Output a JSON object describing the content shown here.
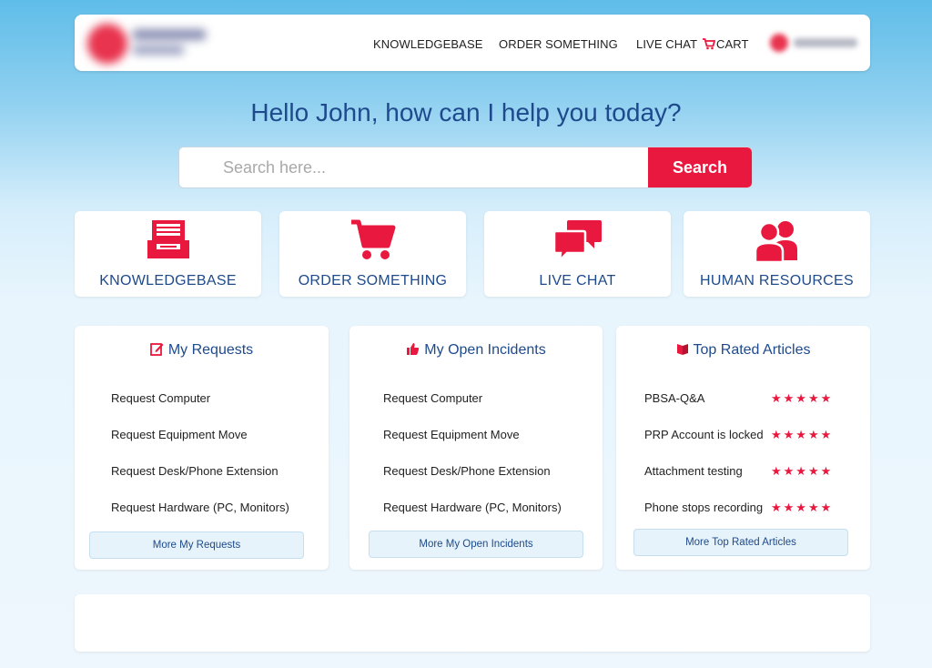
{
  "colors": {
    "accent": "#e8183f",
    "title_blue": "#1e4a8c",
    "button_bg": "#e6f3fb"
  },
  "nav": {
    "knowledgebase": "KNOWLEDGEBASE",
    "order": "ORDER SOMETHING",
    "chat": "LIVE CHAT",
    "cart": "CART"
  },
  "greeting": "Hello John, how can I help you today?",
  "search": {
    "placeholder": "Search here...",
    "button": "Search"
  },
  "tiles": [
    {
      "label": "KNOWLEDGEBASE",
      "icon": "archive-tray-icon"
    },
    {
      "label": "ORDER SOMETHING",
      "icon": "shopping-cart-icon"
    },
    {
      "label": "LIVE CHAT",
      "icon": "chat-bubbles-icon"
    },
    {
      "label": "HUMAN RESOURCES",
      "icon": "people-icon"
    }
  ],
  "cards": {
    "requests": {
      "title": "My Requests",
      "items": [
        "Request Computer",
        "Request Equipment Move",
        "Request Desk/Phone Extension",
        "Request Hardware (PC, Monitors)"
      ],
      "more": "More My Requests"
    },
    "incidents": {
      "title": "My Open Incidents",
      "items": [
        "Request Computer",
        "Request Equipment Move",
        "Request Desk/Phone Extension",
        "Request Hardware (PC, Monitors)"
      ],
      "more": "More My Open Incidents"
    },
    "articles": {
      "title": "Top Rated Articles",
      "items": [
        {
          "name": "PBSA-Q&A",
          "rating": 5
        },
        {
          "name": "PRP Account is locked",
          "rating": 5
        },
        {
          "name": "Attachment testing",
          "rating": 5
        },
        {
          "name": "Phone stops recording",
          "rating": 5
        }
      ],
      "stars_text": "★★★★★",
      "more": "More Top Rated Articles"
    }
  }
}
